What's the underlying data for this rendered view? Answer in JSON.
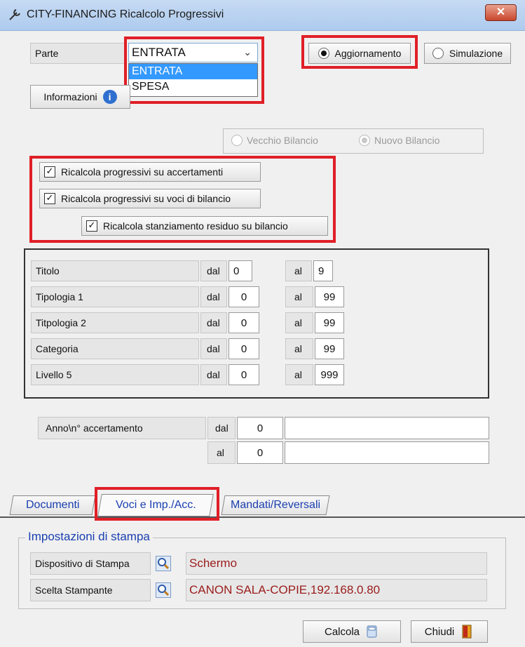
{
  "window": {
    "title": "CITY-FINANCING  Ricalcolo Progressivi",
    "close_label": "✕"
  },
  "parte": {
    "label": "Parte",
    "selected": "ENTRATA",
    "options": [
      "ENTRATA",
      "SPESA"
    ]
  },
  "mode": {
    "aggiornamento": "Aggiornamento",
    "simulazione": "Simulazione",
    "selected": "Aggiornamento"
  },
  "info_button": "Informazioni",
  "bilancio": {
    "vecchio": "Vecchio Bilancio",
    "nuovo": "Nuovo Bilancio",
    "selected": "Nuovo Bilancio"
  },
  "checks": [
    {
      "label": "Ricalcola progressivi su accertamenti",
      "checked": true
    },
    {
      "label": "Ricalcola progressivi su voci di bilancio",
      "checked": true
    },
    {
      "label": "Ricalcola stanziamento residuo su bilancio",
      "checked": true
    }
  ],
  "ranges": [
    {
      "label": "Titolo",
      "dal_label": "dal",
      "dal": "0",
      "al_label": "al",
      "al": "9"
    },
    {
      "label": "Tipologia 1",
      "dal_label": "dal",
      "dal": "0",
      "al_label": "al",
      "al": "99"
    },
    {
      "label": "Titpologia 2",
      "dal_label": "dal",
      "dal": "0",
      "al_label": "al",
      "al": "99"
    },
    {
      "label": "Categoria",
      "dal_label": "dal",
      "dal": "0",
      "al_label": "al",
      "al": "99"
    },
    {
      "label": "Livello 5",
      "dal_label": "dal",
      "dal": "0",
      "al_label": "al",
      "al": "999"
    }
  ],
  "anno": {
    "label": "Anno\\n° accertamento",
    "dal_label": "dal",
    "dal": "0",
    "al_label": "al",
    "al": "0"
  },
  "tabs": [
    "Documenti",
    "Voci e Imp./Acc.",
    "Mandati/Reversali"
  ],
  "stampa": {
    "legend": "Impostazioni di stampa",
    "dispositivo_label": "Dispositivo di Stampa",
    "dispositivo_value": "Schermo",
    "stampante_label": "Scelta Stampante",
    "stampante_value": "CANON SALA-COPIE,192.168.0.80"
  },
  "buttons": {
    "calcola": "Calcola",
    "chiudi": "Chiudi"
  },
  "colors": {
    "highlight": "#e01f27",
    "accent_text": "#9b1c1c",
    "tab_text": "#1a3fb0"
  }
}
